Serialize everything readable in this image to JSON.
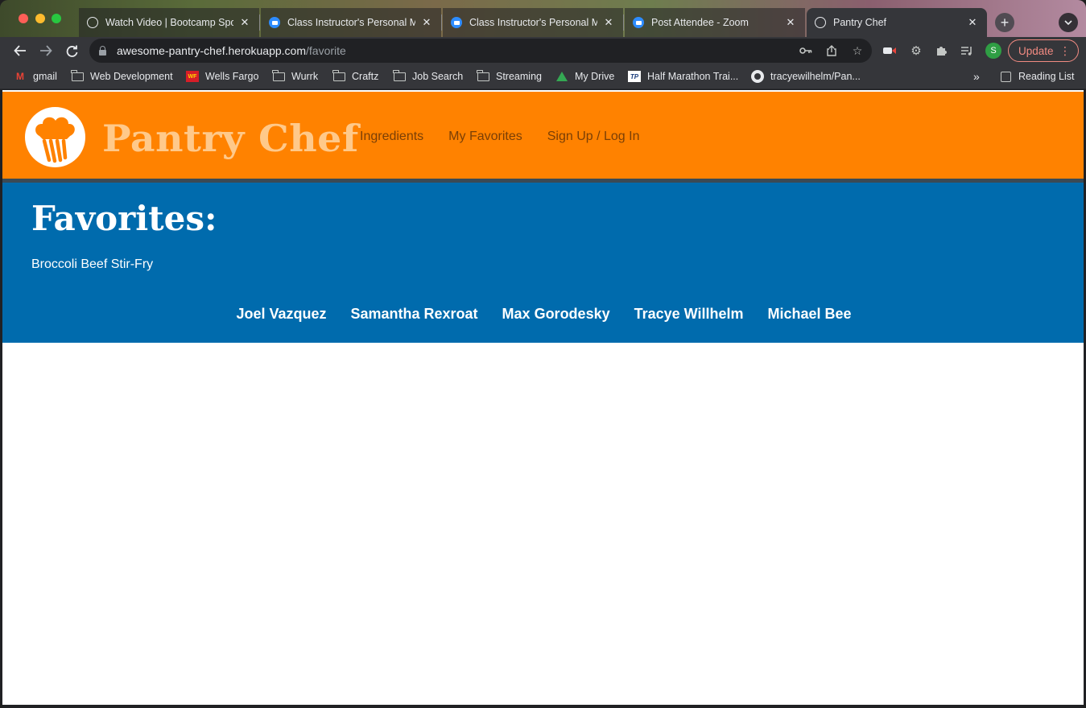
{
  "browser": {
    "tabs": [
      {
        "title": "Watch Video | Bootcamp Spot",
        "icon": "globe-icon"
      },
      {
        "title": "Class Instructor's Personal M",
        "icon": "zoom-icon"
      },
      {
        "title": "Class Instructor's Personal M",
        "icon": "zoom-icon"
      },
      {
        "title": "Post Attendee - Zoom",
        "icon": "zoom-icon"
      },
      {
        "title": "Pantry Chef",
        "icon": "globe-icon",
        "active": true
      }
    ],
    "close_glyph": "✕",
    "new_tab_glyph": "+",
    "url_host": "awesome-pantry-chef.herokuapp.com",
    "url_path": "/favorite",
    "profile_initial": "S",
    "update_label": "Update",
    "bookmarks": [
      {
        "label": "gmail",
        "icon": "gmail-icon"
      },
      {
        "label": "Web Development",
        "icon": "folder-icon"
      },
      {
        "label": "Wells Fargo",
        "icon": "wells-fargo-icon"
      },
      {
        "label": "Wurrk",
        "icon": "folder-icon"
      },
      {
        "label": "Craftz",
        "icon": "folder-icon"
      },
      {
        "label": "Job Search",
        "icon": "folder-icon"
      },
      {
        "label": "Streaming",
        "icon": "folder-icon"
      },
      {
        "label": "My Drive",
        "icon": "drive-icon"
      },
      {
        "label": "Half Marathon Trai...",
        "icon": "training-peaks-icon"
      },
      {
        "label": "tracyewilhelm/Pan...",
        "icon": "github-icon"
      }
    ],
    "overflow_glyph": "»",
    "reading_list_label": "Reading List"
  },
  "site": {
    "brand": "Pantry Chef",
    "nav": [
      "Ingredients",
      "My Favorites",
      "Sign Up / Log In"
    ],
    "favorites_heading": "Favorites:",
    "favorites": [
      "Broccoli Beef Stir-Fry"
    ],
    "credits": [
      "Joel Vazquez",
      "Samantha Rexroat",
      "Max Gorodesky",
      "Tracye Willhelm",
      "Michael Bee"
    ]
  },
  "colors": {
    "header_orange": "#ff8200",
    "brand_text": "#ffc98a",
    "nav_text": "#7a3f06",
    "band_blue": "#006bad",
    "update_red": "#f28b82"
  }
}
